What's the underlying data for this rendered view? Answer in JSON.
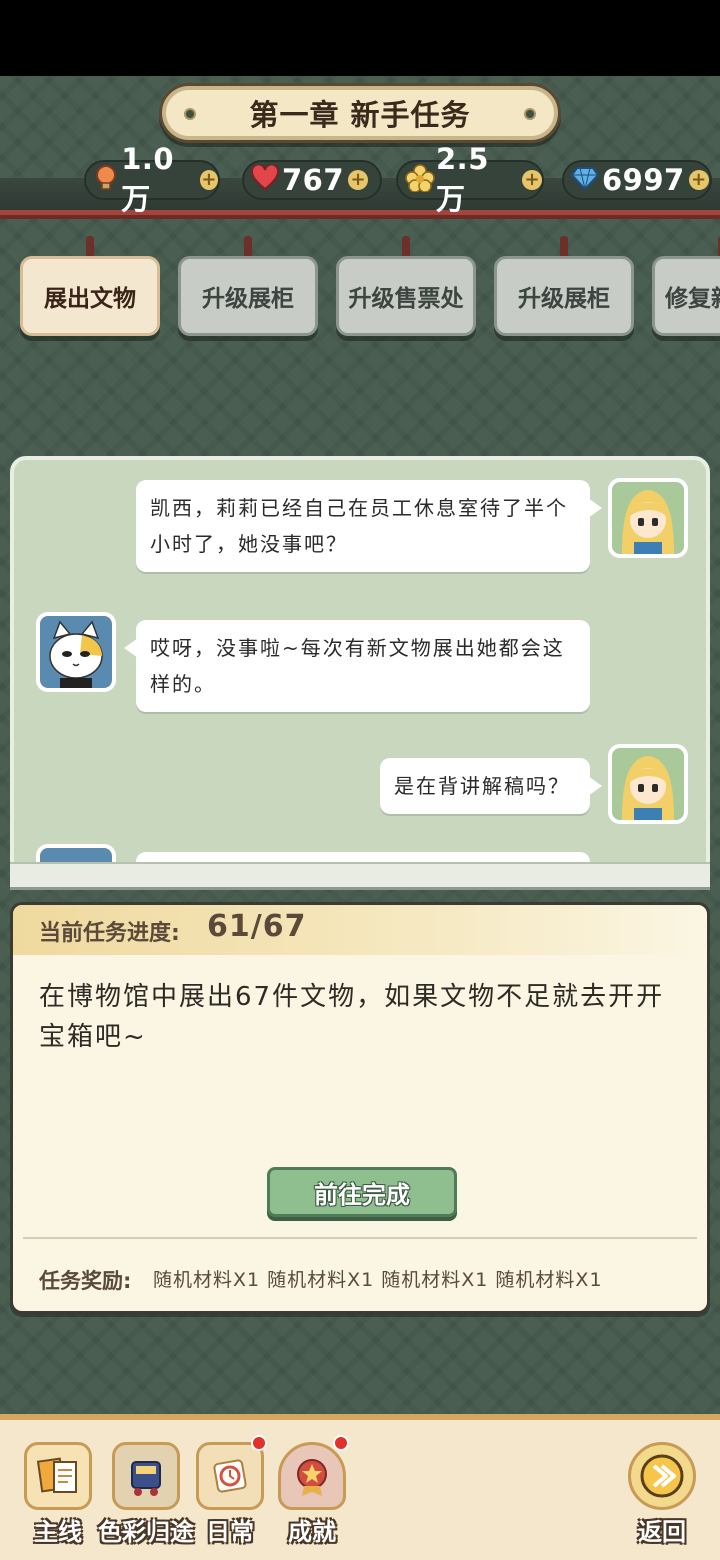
{
  "title": "第一章 新手任务",
  "currencies": [
    {
      "icon": "lightbulb-icon",
      "value": "1.0万"
    },
    {
      "icon": "heart-icon",
      "value": "767"
    },
    {
      "icon": "flower-coin-icon",
      "value": "2.5万"
    },
    {
      "icon": "diamond-icon",
      "value": "6997"
    }
  ],
  "tabs": [
    {
      "label": "展出文物",
      "active": true
    },
    {
      "label": "升级展柜",
      "active": false
    },
    {
      "label": "升级售票处",
      "active": false
    },
    {
      "label": "升级展柜",
      "active": false
    },
    {
      "label": "修复新",
      "active": false
    }
  ],
  "chat": [
    {
      "side": "right",
      "speaker": "girl",
      "text": "凯西，莉莉已经自己在员工休息室待了半个小时了，她没事吧？"
    },
    {
      "side": "left",
      "speaker": "cat",
      "text": "哎呀，没事啦~每次有新文物展出她都会这样的。"
    },
    {
      "side": "right",
      "speaker": "girl",
      "text": "是在背讲解稿吗？"
    }
  ],
  "task": {
    "progress_label": "当前任务进度:",
    "progress_value": "61/67",
    "description": "在博物馆中展出67件文物，如果文物不足就去开开宝箱吧~",
    "go_button": "前往完成",
    "reward_label": "任务奖励:",
    "rewards": "随机材料X1 随机材料X1 随机材料X1 随机材料X1"
  },
  "nav": [
    {
      "label": "主线",
      "icon": "book-icon",
      "badge": false
    },
    {
      "label": "色彩归途",
      "icon": "train-icon",
      "badge": false
    },
    {
      "label": "日常",
      "icon": "clock-icon",
      "badge": true
    },
    {
      "label": "成就",
      "icon": "medal-icon",
      "badge": true
    },
    {
      "label": "返回",
      "icon": "return-arrow-icon",
      "badge": false
    }
  ]
}
